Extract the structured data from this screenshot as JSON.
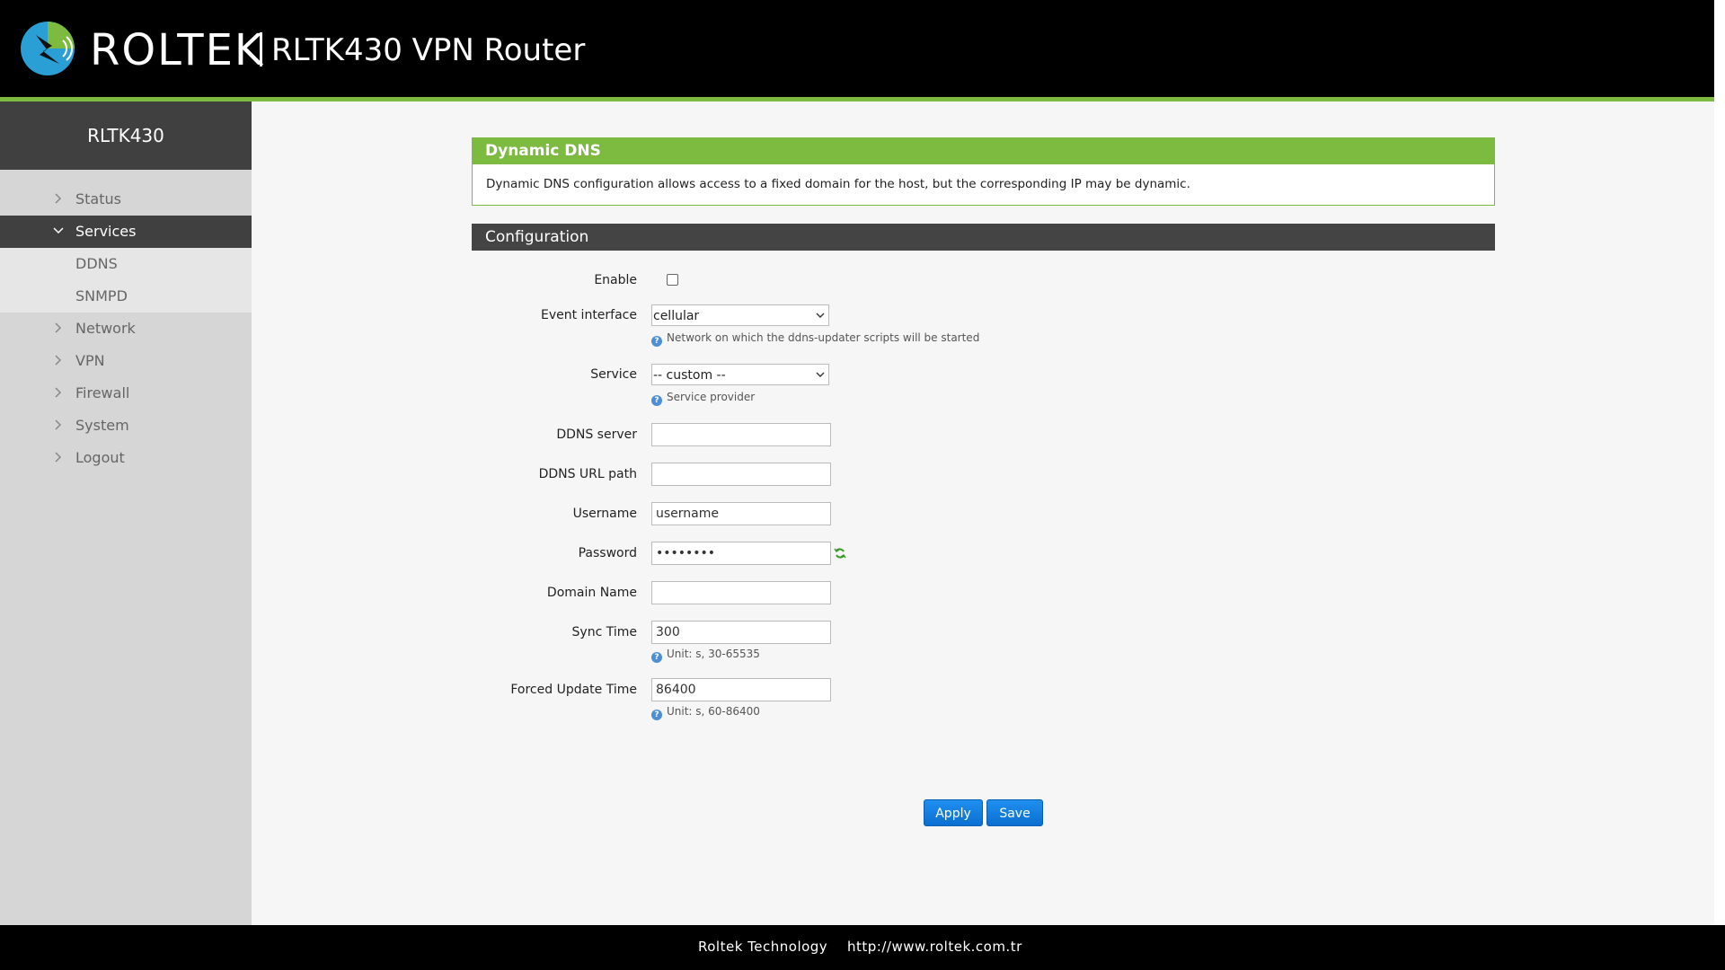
{
  "header": {
    "brand": "ROLTEK",
    "product": "RLTK430 VPN Router"
  },
  "sidebar": {
    "device_name": "RLTK430",
    "items": [
      {
        "label": "Status",
        "expanded": false
      },
      {
        "label": "Services",
        "expanded": true,
        "active": true,
        "children": [
          {
            "label": "DDNS"
          },
          {
            "label": "SNMPD"
          }
        ]
      },
      {
        "label": "Network",
        "expanded": false
      },
      {
        "label": "VPN",
        "expanded": false
      },
      {
        "label": "Firewall",
        "expanded": false
      },
      {
        "label": "System",
        "expanded": false
      },
      {
        "label": "Logout",
        "expanded": false
      }
    ]
  },
  "section": {
    "title": "Dynamic DNS",
    "description": "Dynamic DNS configuration allows access to a fixed domain for the host, but the corresponding IP may be dynamic."
  },
  "config": {
    "title": "Configuration",
    "enable": {
      "label": "Enable",
      "checked": false
    },
    "event_interface": {
      "label": "Event interface",
      "value": "cellular",
      "hint": "Network on which the ddns-updater scripts will be started"
    },
    "service": {
      "label": "Service",
      "value": "-- custom --",
      "hint": "Service provider"
    },
    "ddns_server": {
      "label": "DDNS server",
      "value": ""
    },
    "ddns_url_path": {
      "label": "DDNS URL path",
      "value": ""
    },
    "username": {
      "label": "Username",
      "value": "username"
    },
    "password": {
      "label": "Password",
      "value": "••••••••"
    },
    "domain_name": {
      "label": "Domain Name",
      "value": ""
    },
    "sync_time": {
      "label": "Sync Time",
      "value": "300",
      "hint": "Unit: s, 30-65535"
    },
    "forced_update_time": {
      "label": "Forced Update Time",
      "value": "86400",
      "hint": "Unit: s, 60-86400"
    }
  },
  "actions": {
    "apply_label": "Apply",
    "save_label": "Save"
  },
  "footer": {
    "company": "Roltek Technology",
    "url": "http://www.roltek.com.tr"
  },
  "colors": {
    "accent_green": "#7cbb3f",
    "header_bg": "#000000",
    "sidebar_dark": "#404040",
    "button_blue": "#0a6fd0"
  }
}
